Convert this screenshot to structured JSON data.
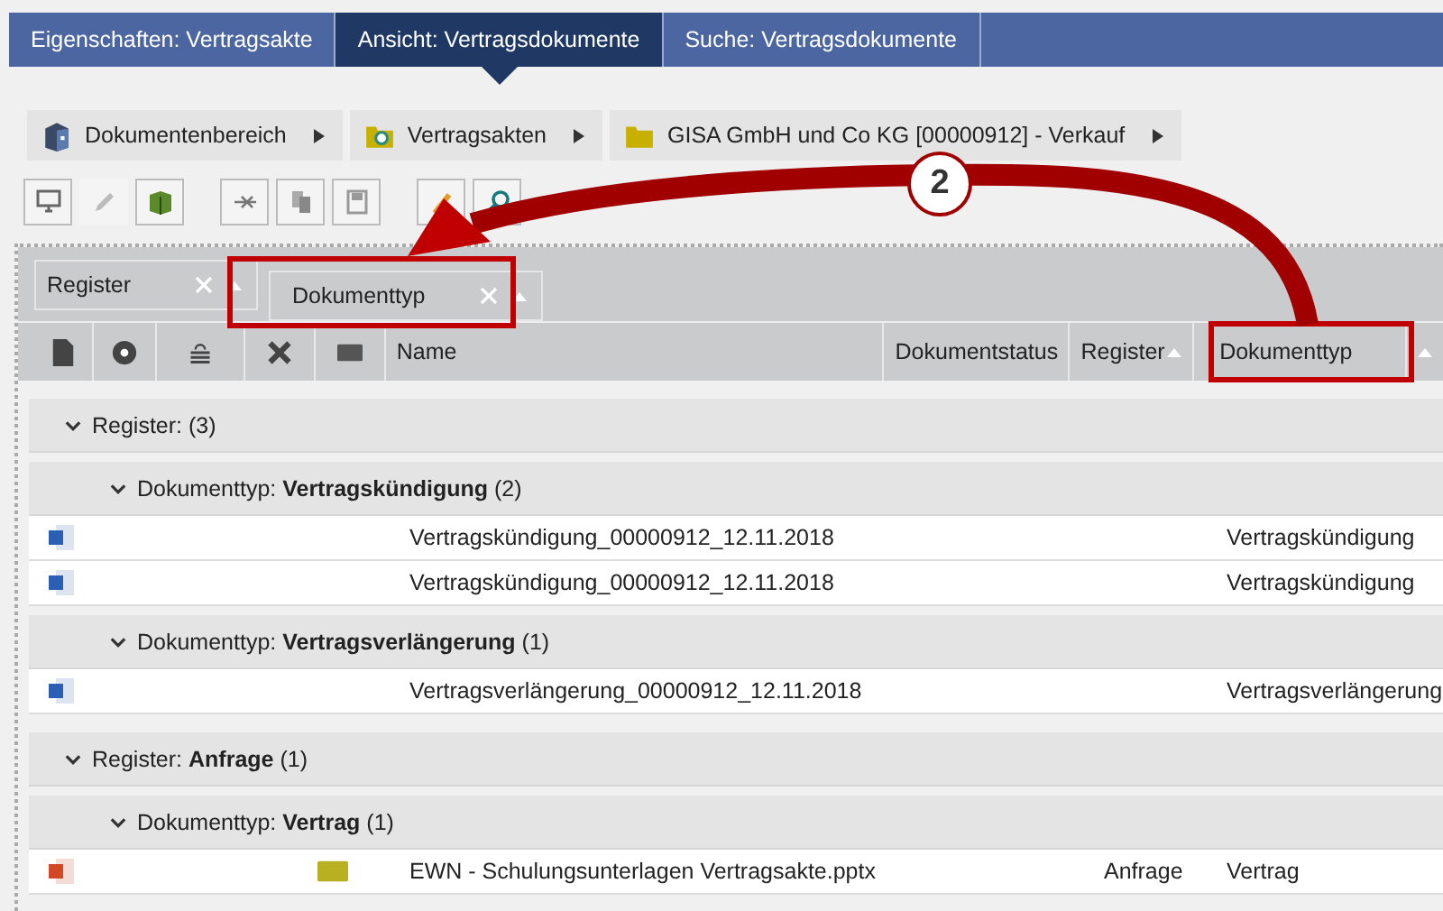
{
  "tabs": [
    {
      "label": "Eigenschaften: Vertragsakte",
      "selected": false
    },
    {
      "label": "Ansicht: Vertragsdokumente",
      "selected": true
    },
    {
      "label": "Suche: Vertragsdokumente",
      "selected": false
    }
  ],
  "breadcrumb": [
    {
      "kind": "area",
      "label": "Dokumentenbereich"
    },
    {
      "kind": "search-folder",
      "label": "Vertragsakten"
    },
    {
      "kind": "folder",
      "label": "GISA GmbH und Co KG [00000912] - Verkauf"
    }
  ],
  "group_by": [
    {
      "label": "Register"
    },
    {
      "label": "Dokumenttyp"
    }
  ],
  "columns": [
    {
      "label": "Name",
      "sorted": false
    },
    {
      "label": "Dokumentstatus",
      "sorted": false
    },
    {
      "label": "Register",
      "sorted": true
    },
    {
      "label": "Dokumenttyp",
      "sorted": false
    },
    {
      "sorted": true
    }
  ],
  "groups": [
    {
      "label": "Register: (3)",
      "children": [
        {
          "label": "Dokumenttyp: **Vertragskündigung** (2)",
          "rows": [
            {
              "kind": "word",
              "tagged": false,
              "name": "Vertragskündigung_00000912_12.11.2018",
              "dokumenttyp": "Vertragskündigung"
            },
            {
              "kind": "word",
              "tagged": false,
              "name": "Vertragskündigung_00000912_12.11.2018",
              "dokumenttyp": "Vertragskündigung"
            }
          ]
        },
        {
          "label": "Dokumenttyp: **Vertragsverlängerung** (1)",
          "rows": [
            {
              "kind": "word",
              "tagged": false,
              "name": "Vertragsverlängerung_00000912_12.11.2018",
              "dokumenttyp": "Vertragsverlängerung"
            }
          ]
        }
      ]
    },
    {
      "label": "Register: **Anfrage** (1)",
      "children": [
        {
          "label": "Dokumenttyp: **Vertrag** (1)",
          "rows": [
            {
              "kind": "powerpoint",
              "tagged": true,
              "name": "EWN - Schulungsunterlagen Vertragsakte.pptx",
              "register": "Anfrage",
              "dokumenttyp": "Vertrag"
            }
          ]
        }
      ]
    }
  ],
  "annotation": {
    "callout": "2"
  }
}
